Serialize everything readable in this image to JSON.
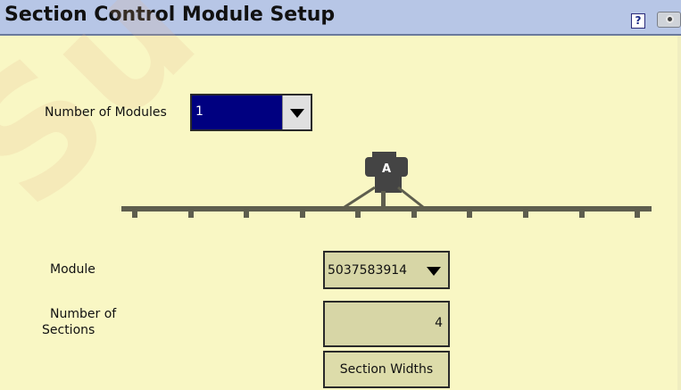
{
  "window": {
    "title": "Section Control Module Setup",
    "help_label": "?"
  },
  "modules": {
    "label": "Number of Modules",
    "value": "1"
  },
  "diagram": {
    "tank_label": "A"
  },
  "module": {
    "label": "Module",
    "value": "5037583914"
  },
  "sections": {
    "label_line1": "Number of",
    "label_line2": "Sections",
    "value": "4"
  },
  "section_widths_button": "Section Widths",
  "colors": {
    "background": "#f9f7c4",
    "titlebar": "#b7c6e6",
    "selected": "#000080",
    "boom": "#5e5e4e"
  },
  "icons": [
    "help-icon",
    "camera-icon",
    "chevron-down-icon"
  ]
}
